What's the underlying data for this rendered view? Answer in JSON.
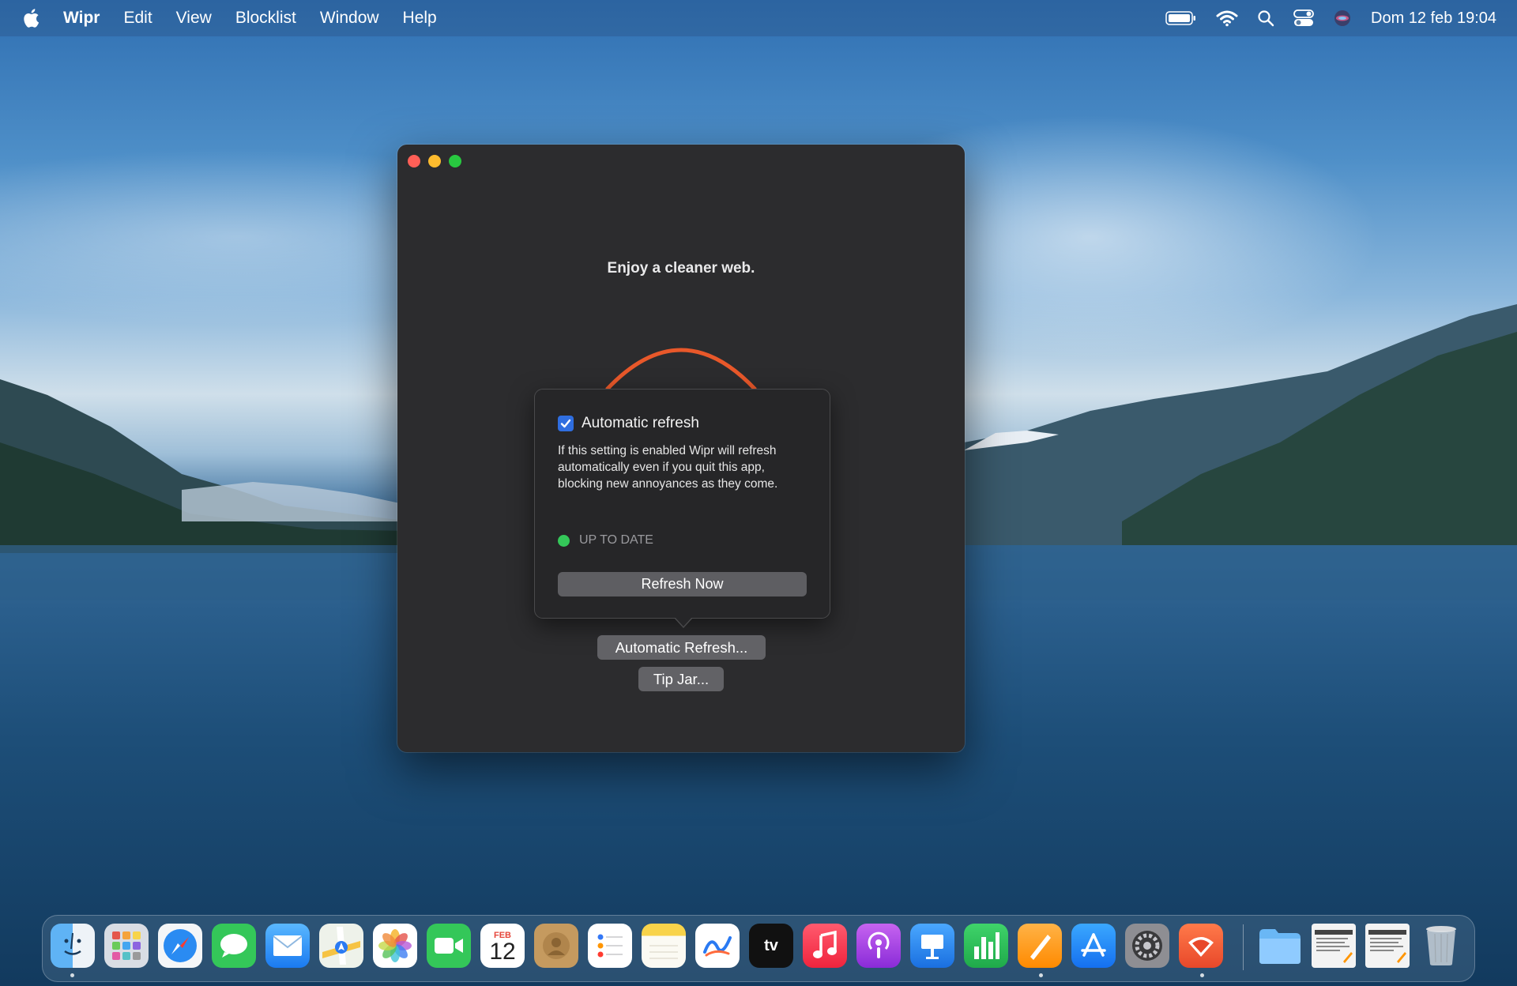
{
  "menubar": {
    "app_name": "Wipr",
    "items": [
      "Edit",
      "View",
      "Blocklist",
      "Window",
      "Help"
    ],
    "clock": "Dom 12 feb  19:04"
  },
  "window": {
    "tagline": "Enjoy a cleaner web.",
    "popover": {
      "checkbox_label": "Automatic refresh",
      "checkbox_checked": true,
      "description": "If this setting is enabled Wipr will refresh automatically even if you quit this app, blocking new annoyances as they come.",
      "status_text": "UP TO DATE",
      "status_color": "#34c759",
      "refresh_button": "Refresh Now"
    },
    "automatic_refresh_button": "Automatic Refresh...",
    "tip_jar_button": "Tip Jar...",
    "accent_color": "#e8582a"
  },
  "dock": {
    "calendar": {
      "month": "FEB",
      "day": "12"
    },
    "apps": [
      "finder",
      "launchpad",
      "safari",
      "messages",
      "mail",
      "maps",
      "photos",
      "facetime",
      "calendar",
      "contacts",
      "reminders",
      "notes",
      "freeform",
      "tv",
      "music",
      "podcasts",
      "keynote",
      "numbers",
      "pages",
      "app-store",
      "system-settings",
      "wipr",
      "downloads-folder",
      "document-1",
      "document-2",
      "trash"
    ]
  }
}
